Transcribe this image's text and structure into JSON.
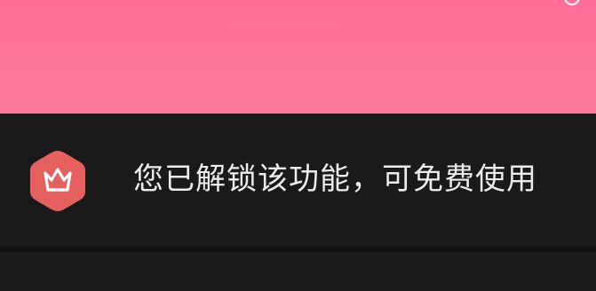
{
  "banner": {
    "color": "#ff6e98"
  },
  "unlock_notice": {
    "text": "您已解锁该功能，可免费使用",
    "icon": "crown-icon",
    "icon_bg_color": "#e5605f"
  },
  "next_section": {
    "partial_title": ""
  }
}
